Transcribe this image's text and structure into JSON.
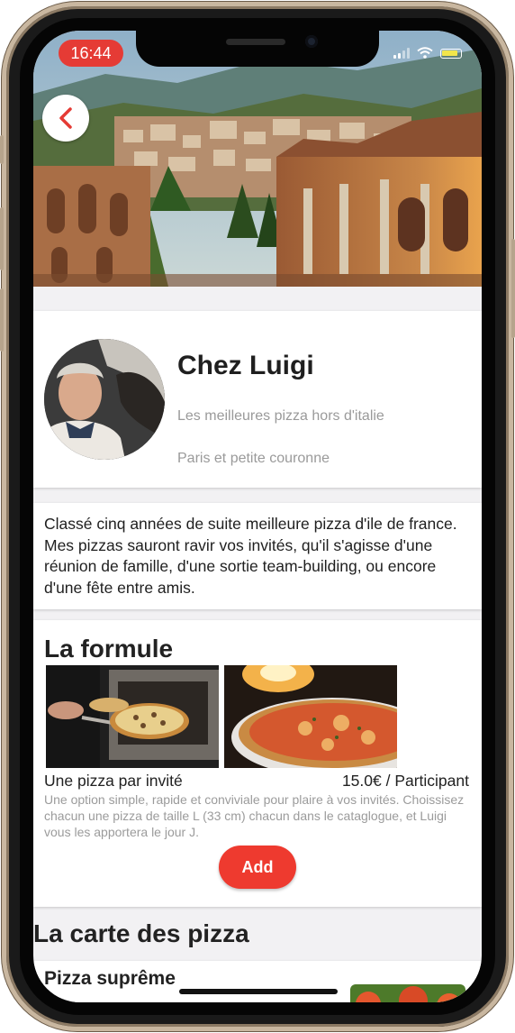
{
  "status_bar": {
    "time": "16:44"
  },
  "hero": {
    "back_icon": "chevron-left-icon",
    "image": "ancient-theatre-cityscape"
  },
  "profile": {
    "name": "Chez Luigi",
    "tagline": "Les meilleures pizza hors d'italie",
    "location": "Paris et petite couronne",
    "avatar": "chef-portrait"
  },
  "description": "Classé cinq années de suite meilleure pizza d'ile de france. Mes pizzas sauront ravir vos invités, qu'il s'agisse d'une réunion de famille, d'une sortie team-building, ou encore d'une fête entre amis.",
  "formula": {
    "title": "La formule",
    "option_label": "Une pizza par invité",
    "price": "15.0€ / Participant",
    "description": "Une option simple, rapide et conviviale pour plaire à vos invités. Choissisez chacun une pizza de taille L (33 cm) chacun dans le cataglogue, et Luigi vous les apportera le jour J.",
    "add_label": "Add"
  },
  "menu": {
    "title": "La carte des pizza",
    "items": [
      {
        "name": "Pizza suprême"
      }
    ]
  },
  "colors": {
    "accent": "#ee3a2f",
    "time_pill": "#e53b35",
    "muted_text": "#9a9a9a"
  }
}
